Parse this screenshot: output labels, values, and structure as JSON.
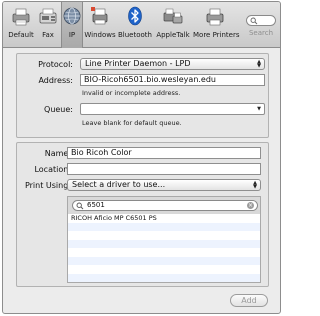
{
  "toolbar": {
    "items": [
      {
        "label": "Default",
        "icon": "default-printers-icon"
      },
      {
        "label": "Fax",
        "icon": "fax-icon"
      },
      {
        "label": "IP",
        "icon": "ip-globe-icon",
        "selected": true
      },
      {
        "label": "Windows",
        "icon": "windows-printer-icon"
      },
      {
        "label": "Bluetooth",
        "icon": "bluetooth-icon"
      },
      {
        "label": "AppleTalk",
        "icon": "appletalk-icon"
      },
      {
        "label": "More Printers",
        "icon": "more-printers-icon"
      }
    ],
    "search_label": "Search"
  },
  "connection": {
    "protocol_label": "Protocol:",
    "protocol_value": "Line Printer Daemon - LPD",
    "address_label": "Address:",
    "address_value": "BIO-Ricoh6501.bio.wesleyan.edu",
    "address_hint": "Invalid or incomplete address.",
    "queue_label": "Queue:",
    "queue_value": "",
    "queue_hint": "Leave blank for default queue."
  },
  "printer": {
    "name_label": "Name:",
    "name_value": "Bio Ricoh Color",
    "location_label": "Location:",
    "location_value": "",
    "print_using_label": "Print Using:",
    "print_using_value": "Select a driver to use..."
  },
  "drivers": {
    "search_value": "6501",
    "items": [
      "RICOH Aficio MP C6501 PS"
    ]
  },
  "actions": {
    "add_label": "Add"
  },
  "colors": {
    "selection_row": "#edf3fe",
    "bluetooth_blue": "#1f63c9"
  }
}
